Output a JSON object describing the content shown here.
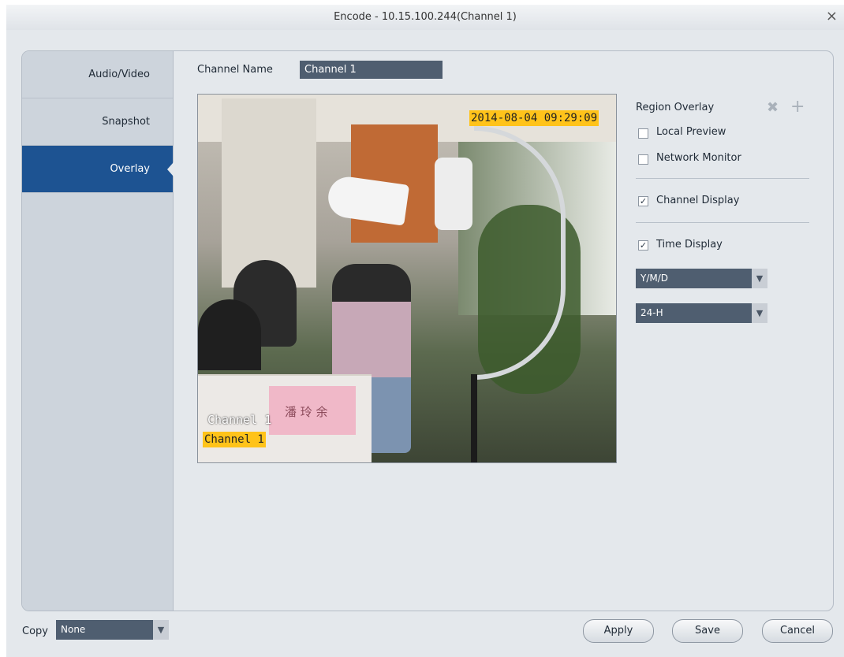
{
  "window": {
    "title": "Encode - 10.15.100.244(Channel 1)",
    "close_glyph": "×"
  },
  "sidebar": {
    "items": [
      {
        "label": "Audio/Video",
        "active": false
      },
      {
        "label": "Snapshot",
        "active": false
      },
      {
        "label": "Overlay",
        "active": true
      }
    ]
  },
  "channel_name": {
    "label": "Channel Name",
    "value": "Channel 1"
  },
  "preview": {
    "timestamp": "2014-08-04 09:29:09",
    "channel_overlay": "Channel 1",
    "ghost_text": "Channel 1",
    "sign_text": "潘 玲 余"
  },
  "overlay_settings": {
    "region_overlay_label": "Region Overlay",
    "delete_icon": "close-icon",
    "add_icon": "plus-icon",
    "local_preview": {
      "label": "Local Preview",
      "checked": false
    },
    "network_monitor": {
      "label": "Network Monitor",
      "checked": false
    },
    "channel_display": {
      "label": "Channel Display",
      "checked": true
    },
    "time_display": {
      "label": "Time Display",
      "checked": true
    },
    "date_format": "Y/M/D",
    "time_format": "24-H"
  },
  "footer": {
    "copy_label": "Copy",
    "copy_value": "None",
    "apply_label": "Apply",
    "save_label": "Save",
    "cancel_label": "Cancel"
  },
  "colors": {
    "active_tab": "#1d5392",
    "overlay_highlight": "#ffc31a",
    "input_bg": "#4f5e70"
  }
}
